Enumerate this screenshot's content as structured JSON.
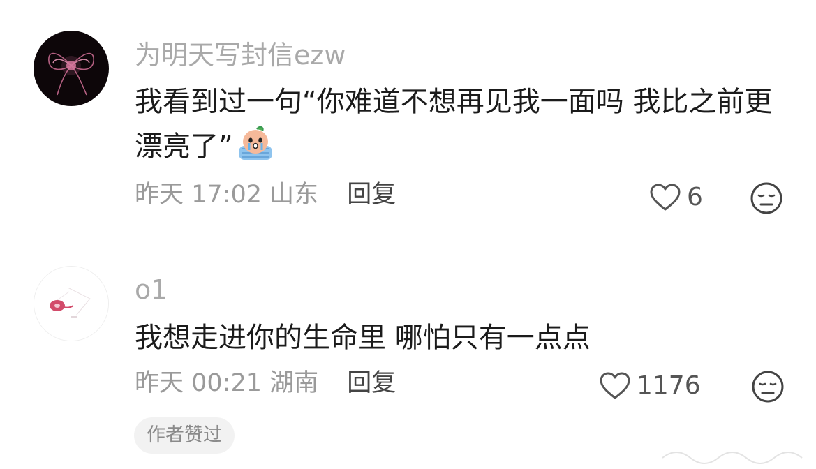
{
  "comments": [
    {
      "username": "为明天写封信ezw",
      "text": "我看到过一句“你难道不想再见我一面吗 我比之前更漂亮了”",
      "emoji": "crying-face-emoji",
      "time": "昨天 17:02",
      "location": "山东",
      "reply_label": "回复",
      "likes": "6",
      "avatar_icon": "dark-bow-avatar"
    },
    {
      "username": "o1",
      "text": "我想走进你的生命里 哪怕只有一点点",
      "time": "昨天 00:21",
      "location": "湖南",
      "reply_label": "回复",
      "likes": "1176",
      "avatar_icon": "pink-ribbon-avatar",
      "badge": "作者赞过"
    }
  ],
  "icons": {
    "like": "heart-outline-icon",
    "face": "neutral-face-icon"
  },
  "colors": {
    "username": "#a9a9a9",
    "text": "#1b1b1b",
    "meta": "#9a9a9a",
    "badge_bg": "#f2f2f2"
  }
}
